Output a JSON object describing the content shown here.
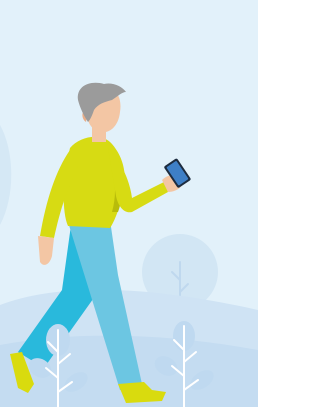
{
  "illustration": {
    "subject": "man-walking-with-phone",
    "icons": [
      "phone-icon"
    ],
    "colors": {
      "sky": "#E2F1FA",
      "hill": "#C9E0F3",
      "hill_light": "#D6E9F6",
      "bush": "#D2E6F4",
      "plant_leaf": "#BFD9F0",
      "plant_stem": "#FFFFFF",
      "hair": "#9B9B9B",
      "skin": "#F3C6A4",
      "sweater": "#D7DB13",
      "sweater_shadow": "#B8BC0A",
      "pants_front": "#6CC6E2",
      "pants_back": "#29B9DC",
      "shoe": "#D9DB0E",
      "phone": "#3E7FC6",
      "phone_dark": "#1D2C3F"
    }
  }
}
